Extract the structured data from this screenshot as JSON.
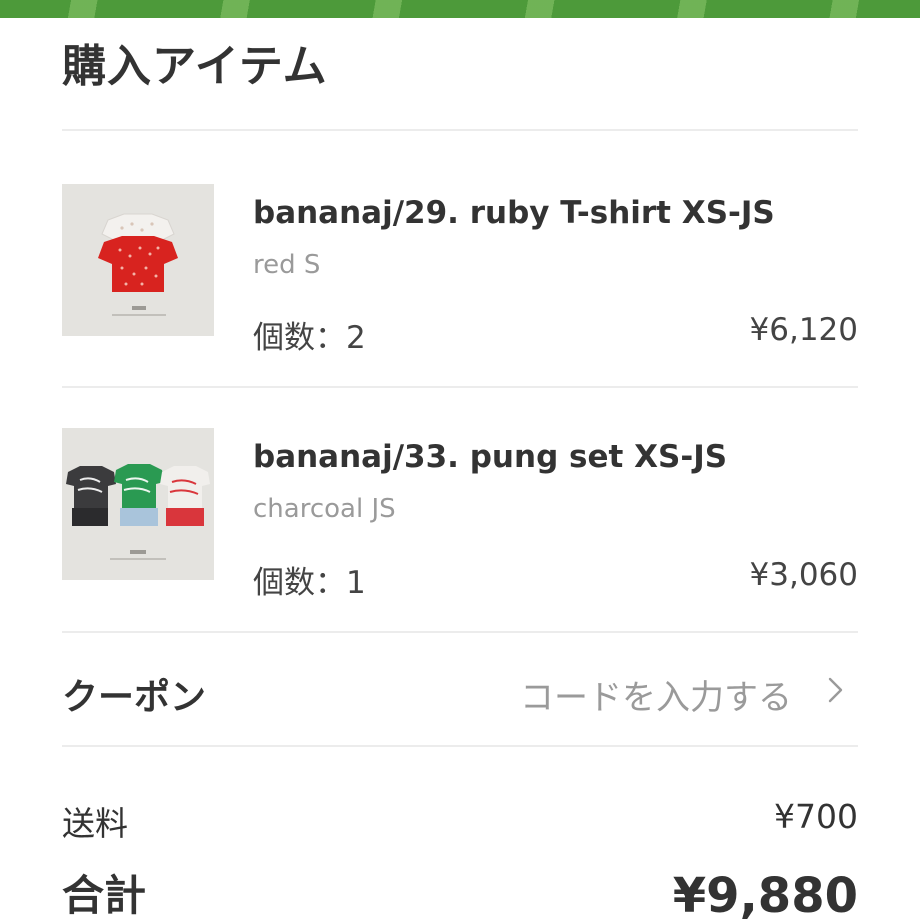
{
  "header": {
    "title": "購入アイテム"
  },
  "items": [
    {
      "name": "bananaj/29. ruby T-shirt XS-JS",
      "variant": "red S",
      "quantity_label": "個数：2",
      "price": "¥6,120"
    },
    {
      "name": "bananaj/33. pung set XS-JS",
      "variant": "charcoal JS",
      "quantity_label": "個数：1",
      "price": "¥3,060"
    }
  ],
  "coupon": {
    "label": "クーポン",
    "placeholder": "コードを入力する",
    "icon": "chevron-right-icon"
  },
  "summary": {
    "shipping_label": "送料",
    "shipping_value": "¥700",
    "total_label": "合計",
    "total_value": "¥9,880"
  },
  "colors": {
    "accent_bar": "#4d9a3a",
    "text": "#333333",
    "muted": "#9a9a9a",
    "divider": "#ececec"
  }
}
